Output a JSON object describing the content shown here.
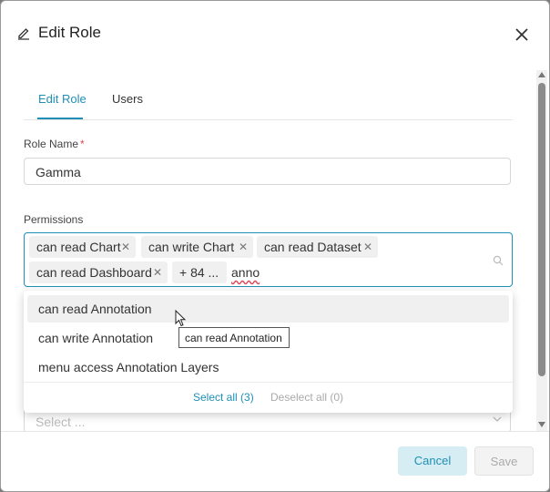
{
  "modal": {
    "title": "Edit Role"
  },
  "tabs": [
    {
      "label": "Edit Role",
      "active": true
    },
    {
      "label": "Users",
      "active": false
    }
  ],
  "role_name": {
    "label": "Role Name",
    "required_mark": "*",
    "value": "Gamma"
  },
  "permissions": {
    "label": "Permissions",
    "tags": [
      "can read Chart",
      "can write Chart",
      "can read Dataset",
      "can read Dashboard",
      "+ 84 ..."
    ],
    "search_value": "anno"
  },
  "dropdown": {
    "options": [
      "can read Annotation",
      "can write Annotation",
      "menu access Annotation Layers"
    ],
    "select_all": "Select all (3)",
    "deselect_all": "Deselect all (0)"
  },
  "tooltip": "can read Annotation",
  "next_field": {
    "placeholder": "Select ..."
  },
  "footer": {
    "cancel": "Cancel",
    "save": "Save"
  },
  "colors": {
    "accent": "#1f8fb5",
    "required": "#e04355"
  }
}
